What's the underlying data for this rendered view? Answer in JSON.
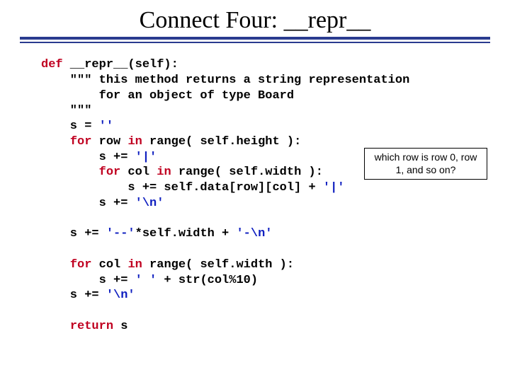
{
  "title": "Connect Four:    __repr__",
  "code": {
    "l01a": "def",
    "l01b": " __repr__(self):",
    "l02": "    \"\"\" this method returns a string representation",
    "l03": "        for an object of type Board",
    "l04": "    \"\"\"",
    "l05a": "    s = ",
    "l05b": "''",
    "l06a": "    ",
    "l06b": "for",
    "l06c": " row ",
    "l06d": "in",
    "l06e": " range( self.height ):",
    "l07a": "        s += ",
    "l07b": "'|'",
    "l08a": "        ",
    "l08b": "for",
    "l08c": " col ",
    "l08d": "in",
    "l08e": " range( self.width ):",
    "l09a": "            s += self.data[row][col] + ",
    "l09b": "'|'",
    "l10a": "        s += ",
    "l10b": "'\\n'",
    "sep1": "",
    "l11a": "    s += ",
    "l11b": "'--'",
    "l11c": "*self.width + ",
    "l11d": "'-\\n'",
    "sep2": "",
    "l12a": "    ",
    "l12b": "for",
    "l12c": " col ",
    "l12d": "in",
    "l12e": " range( self.width ):",
    "l13a": "        s += ",
    "l13b": "' '",
    "l13c": " + str(col%10)",
    "l14a": "    s += ",
    "l14b": "'\\n'",
    "sep3": "",
    "l15a": "    ",
    "l15b": "return",
    "l15c": " s"
  },
  "annotation": "which row is row 0, row 1, and so on?"
}
